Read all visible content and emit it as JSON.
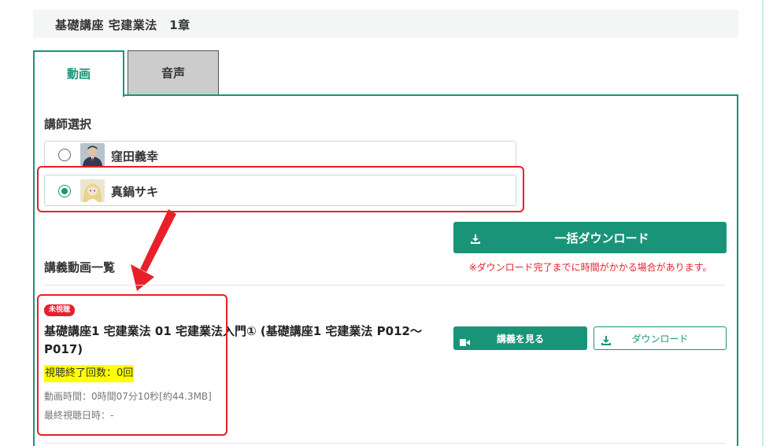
{
  "section": {
    "title": "基礎講座 宅建業法　1章"
  },
  "tabs": [
    {
      "label": "動画",
      "active": true
    },
    {
      "label": "音声",
      "active": false
    }
  ],
  "lecturer": {
    "heading": "講師選択",
    "options": [
      {
        "name": "窪田義幸",
        "selected": false
      },
      {
        "name": "真鍋サキ",
        "selected": true
      }
    ]
  },
  "bulk_download": {
    "label": "一括ダウンロード",
    "note": "※ダウンロード完了までに時間がかかる場合があります。"
  },
  "lecture_list": {
    "heading": "講義動画一覧",
    "items": [
      {
        "badge": "未視聴",
        "title": "基礎講座1 宅建業法 01 宅建業法入門① (基礎講座1 宅建業法 P012～P017)",
        "view_count": "視聴終了回数：0回",
        "duration": "動画時間：0時間07分10秒[約44.3MB]",
        "last_viewed": "最終視聴日時：-",
        "watch_label": "講義を見る",
        "download_label": "ダウンロード"
      }
    ]
  },
  "colors": {
    "accent": "#1a9479",
    "alert": "#e8202a",
    "highlight": "#ffff00",
    "inactive_tab": "#cccccc"
  },
  "icons": {
    "download": "download-icon",
    "camera": "video-camera-icon"
  }
}
